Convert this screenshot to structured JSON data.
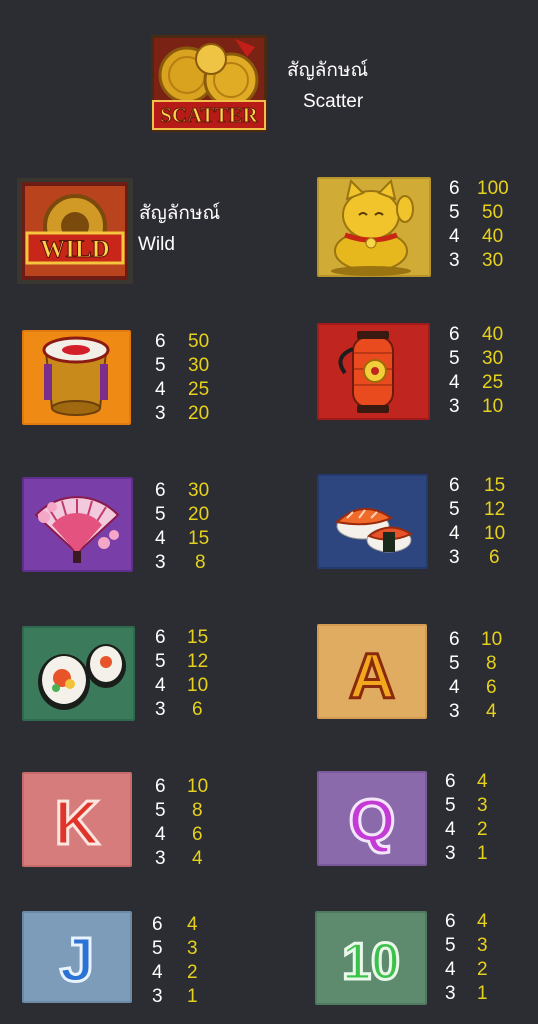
{
  "scatter": {
    "icon": "scatter-icon",
    "label_thai": "สัญลักษณ์",
    "label_en": "Scatter",
    "badge_text": "SCATTER"
  },
  "wild": {
    "icon": "wild-icon",
    "label_thai": "สัญลักษณ์",
    "label_en": "Wild",
    "badge_text": "WILD"
  },
  "colors": {
    "background": "#2c2c33",
    "count_text": "#ffffff",
    "payout_text": "#e6d21c"
  },
  "symbols": [
    {
      "icon": "lucky-cat-icon",
      "pays": [
        {
          "count": "6",
          "value": "100"
        },
        {
          "count": "5",
          "value": "50"
        },
        {
          "count": "4",
          "value": "40"
        },
        {
          "count": "3",
          "value": "30"
        }
      ]
    },
    {
      "icon": "drum-icon",
      "pays": [
        {
          "count": "6",
          "value": "50"
        },
        {
          "count": "5",
          "value": "30"
        },
        {
          "count": "4",
          "value": "25"
        },
        {
          "count": "3",
          "value": "20"
        }
      ]
    },
    {
      "icon": "lantern-icon",
      "pays": [
        {
          "count": "6",
          "value": "40"
        },
        {
          "count": "5",
          "value": "30"
        },
        {
          "count": "4",
          "value": "25"
        },
        {
          "count": "3",
          "value": "10"
        }
      ]
    },
    {
      "icon": "fan-icon",
      "pays": [
        {
          "count": "6",
          "value": "30"
        },
        {
          "count": "5",
          "value": "20"
        },
        {
          "count": "4",
          "value": "15"
        },
        {
          "count": "3",
          "value": "8"
        }
      ]
    },
    {
      "icon": "nigiri-icon",
      "pays": [
        {
          "count": "6",
          "value": "15"
        },
        {
          "count": "5",
          "value": "12"
        },
        {
          "count": "4",
          "value": "10"
        },
        {
          "count": "3",
          "value": "6"
        }
      ]
    },
    {
      "icon": "sushi-roll-icon",
      "pays": [
        {
          "count": "6",
          "value": "15"
        },
        {
          "count": "5",
          "value": "12"
        },
        {
          "count": "4",
          "value": "10"
        },
        {
          "count": "3",
          "value": "6"
        }
      ]
    },
    {
      "icon": "letter-a-icon",
      "glyph": "A",
      "pays": [
        {
          "count": "6",
          "value": "10"
        },
        {
          "count": "5",
          "value": "8"
        },
        {
          "count": "4",
          "value": "6"
        },
        {
          "count": "3",
          "value": "4"
        }
      ]
    },
    {
      "icon": "letter-k-icon",
      "glyph": "K",
      "pays": [
        {
          "count": "6",
          "value": "10"
        },
        {
          "count": "5",
          "value": "8"
        },
        {
          "count": "4",
          "value": "6"
        },
        {
          "count": "3",
          "value": "4"
        }
      ]
    },
    {
      "icon": "letter-q-icon",
      "glyph": "Q",
      "pays": [
        {
          "count": "6",
          "value": "4"
        },
        {
          "count": "5",
          "value": "3"
        },
        {
          "count": "4",
          "value": "2"
        },
        {
          "count": "3",
          "value": "1"
        }
      ]
    },
    {
      "icon": "letter-j-icon",
      "glyph": "J",
      "pays": [
        {
          "count": "6",
          "value": "4"
        },
        {
          "count": "5",
          "value": "3"
        },
        {
          "count": "4",
          "value": "2"
        },
        {
          "count": "3",
          "value": "1"
        }
      ]
    },
    {
      "icon": "number-10-icon",
      "glyph": "10",
      "pays": [
        {
          "count": "6",
          "value": "4"
        },
        {
          "count": "5",
          "value": "3"
        },
        {
          "count": "4",
          "value": "2"
        },
        {
          "count": "3",
          "value": "1"
        }
      ]
    }
  ]
}
